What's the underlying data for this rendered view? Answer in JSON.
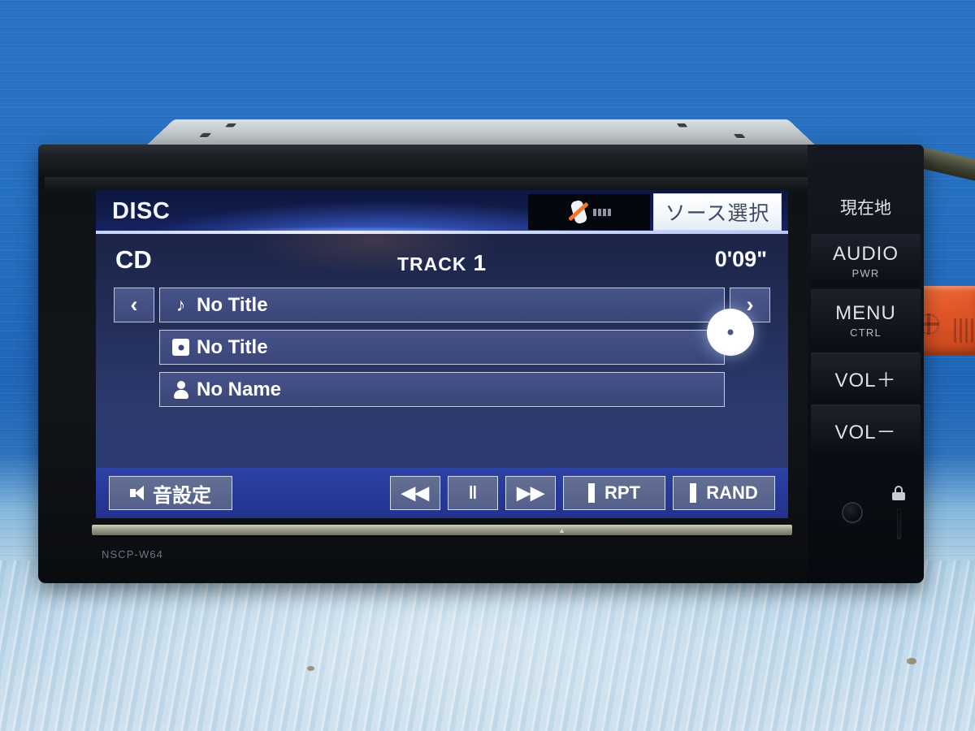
{
  "screen": {
    "header": {
      "source_label": "DISC",
      "phone_icon": "phone-disconnected-icon",
      "source_select_label": "ソース選択"
    },
    "now_playing": {
      "media_label": "CD",
      "track_label": "TRACK",
      "track_number": "1",
      "elapsed_time": "0'09\"",
      "disc_indicator_icon": "disc-icon"
    },
    "info_rows": [
      {
        "icon": "music-note-icon",
        "glyph": "♪",
        "value": "No Title"
      },
      {
        "icon": "disc-icon",
        "glyph": "",
        "value": "No Title"
      },
      {
        "icon": "person-icon",
        "glyph": "",
        "value": "No Name"
      }
    ],
    "nav": {
      "prev_label": "‹",
      "next_label": "›"
    },
    "controls": {
      "sound_settings_label": "音設定",
      "sound_icon": "speaker-icon",
      "rewind_label": "◀◀",
      "pause_label": "‖",
      "forward_label": "▶▶",
      "repeat_label": "RPT",
      "random_label": "RAND"
    }
  },
  "hardware": {
    "model_name": "NSCP-W64",
    "current_location_label": "現在地",
    "keys": [
      {
        "main": "AUDIO",
        "sub": "PWR"
      },
      {
        "main": "MENU",
        "sub": "CTRL"
      },
      {
        "main": "VOL＋",
        "sub": ""
      },
      {
        "main": "VOL－",
        "sub": ""
      }
    ],
    "reset_icon": "reset-button-icon",
    "lock_icon": "lock-icon"
  },
  "colors": {
    "backdrop_blue": "#2a72c4",
    "screen_blue": "#2c3a6e",
    "header_blue": "#111c4c",
    "control_bar_blue": "#27399a",
    "accent_orange": "#f2762a",
    "button_grey": "#5b6690"
  }
}
